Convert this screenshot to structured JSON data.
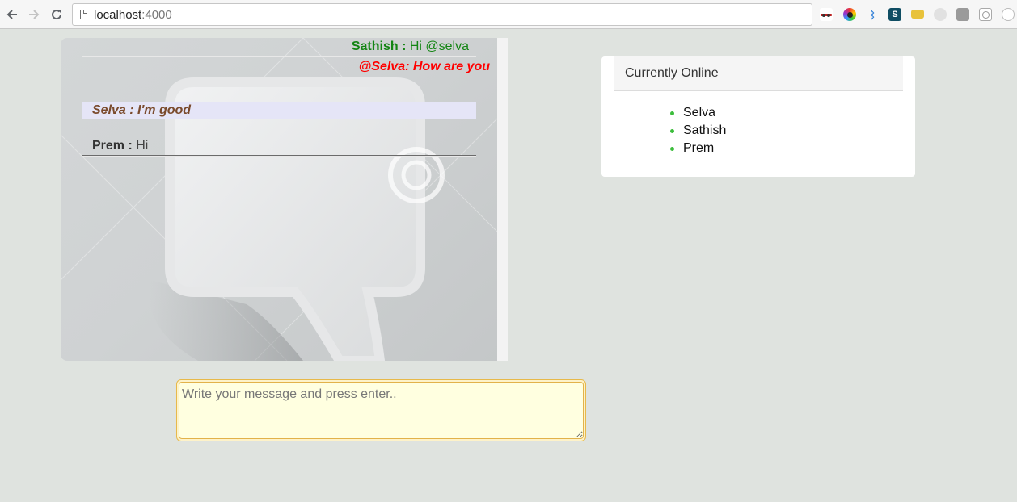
{
  "browser": {
    "url_host": "localhost",
    "url_port": ":4000",
    "back_icon": "arrow-left-icon",
    "forward_icon": "arrow-right-icon",
    "reload_icon": "reload-icon"
  },
  "chat": {
    "messages": [
      {
        "name": "Sathish :",
        "text": " Hi @selva",
        "color": "#138513"
      },
      {
        "text": "@Selva: How are you",
        "color": "#ff0000"
      },
      {
        "text": "Selva : I'm good",
        "color": "#7a4a2c"
      },
      {
        "name": "Prem :",
        "text": " Hi",
        "color": "#333333"
      }
    ]
  },
  "online": {
    "title": "Currently Online",
    "users": [
      "Selva",
      "Sathish",
      "Prem"
    ],
    "dot_color": "#3cbd3c"
  },
  "composer": {
    "placeholder": "Write your message and press enter.."
  }
}
